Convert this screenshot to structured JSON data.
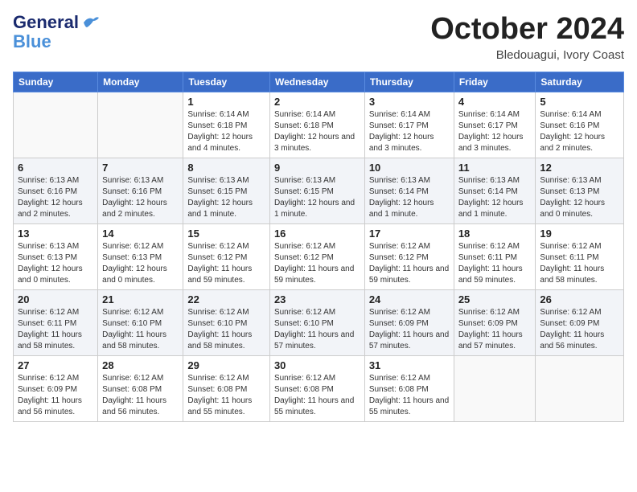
{
  "header": {
    "logo_line1": "General",
    "logo_line2": "Blue",
    "month": "October 2024",
    "location": "Bledouagui, Ivory Coast"
  },
  "weekdays": [
    "Sunday",
    "Monday",
    "Tuesday",
    "Wednesday",
    "Thursday",
    "Friday",
    "Saturday"
  ],
  "weeks": [
    [
      {
        "day": "",
        "sunrise": "",
        "sunset": "",
        "daylight": ""
      },
      {
        "day": "",
        "sunrise": "",
        "sunset": "",
        "daylight": ""
      },
      {
        "day": "1",
        "sunrise": "Sunrise: 6:14 AM",
        "sunset": "Sunset: 6:18 PM",
        "daylight": "Daylight: 12 hours and 4 minutes."
      },
      {
        "day": "2",
        "sunrise": "Sunrise: 6:14 AM",
        "sunset": "Sunset: 6:18 PM",
        "daylight": "Daylight: 12 hours and 3 minutes."
      },
      {
        "day": "3",
        "sunrise": "Sunrise: 6:14 AM",
        "sunset": "Sunset: 6:17 PM",
        "daylight": "Daylight: 12 hours and 3 minutes."
      },
      {
        "day": "4",
        "sunrise": "Sunrise: 6:14 AM",
        "sunset": "Sunset: 6:17 PM",
        "daylight": "Daylight: 12 hours and 3 minutes."
      },
      {
        "day": "5",
        "sunrise": "Sunrise: 6:14 AM",
        "sunset": "Sunset: 6:16 PM",
        "daylight": "Daylight: 12 hours and 2 minutes."
      }
    ],
    [
      {
        "day": "6",
        "sunrise": "Sunrise: 6:13 AM",
        "sunset": "Sunset: 6:16 PM",
        "daylight": "Daylight: 12 hours and 2 minutes."
      },
      {
        "day": "7",
        "sunrise": "Sunrise: 6:13 AM",
        "sunset": "Sunset: 6:16 PM",
        "daylight": "Daylight: 12 hours and 2 minutes."
      },
      {
        "day": "8",
        "sunrise": "Sunrise: 6:13 AM",
        "sunset": "Sunset: 6:15 PM",
        "daylight": "Daylight: 12 hours and 1 minute."
      },
      {
        "day": "9",
        "sunrise": "Sunrise: 6:13 AM",
        "sunset": "Sunset: 6:15 PM",
        "daylight": "Daylight: 12 hours and 1 minute."
      },
      {
        "day": "10",
        "sunrise": "Sunrise: 6:13 AM",
        "sunset": "Sunset: 6:14 PM",
        "daylight": "Daylight: 12 hours and 1 minute."
      },
      {
        "day": "11",
        "sunrise": "Sunrise: 6:13 AM",
        "sunset": "Sunset: 6:14 PM",
        "daylight": "Daylight: 12 hours and 1 minute."
      },
      {
        "day": "12",
        "sunrise": "Sunrise: 6:13 AM",
        "sunset": "Sunset: 6:13 PM",
        "daylight": "Daylight: 12 hours and 0 minutes."
      }
    ],
    [
      {
        "day": "13",
        "sunrise": "Sunrise: 6:13 AM",
        "sunset": "Sunset: 6:13 PM",
        "daylight": "Daylight: 12 hours and 0 minutes."
      },
      {
        "day": "14",
        "sunrise": "Sunrise: 6:12 AM",
        "sunset": "Sunset: 6:13 PM",
        "daylight": "Daylight: 12 hours and 0 minutes."
      },
      {
        "day": "15",
        "sunrise": "Sunrise: 6:12 AM",
        "sunset": "Sunset: 6:12 PM",
        "daylight": "Daylight: 11 hours and 59 minutes."
      },
      {
        "day": "16",
        "sunrise": "Sunrise: 6:12 AM",
        "sunset": "Sunset: 6:12 PM",
        "daylight": "Daylight: 11 hours and 59 minutes."
      },
      {
        "day": "17",
        "sunrise": "Sunrise: 6:12 AM",
        "sunset": "Sunset: 6:12 PM",
        "daylight": "Daylight: 11 hours and 59 minutes."
      },
      {
        "day": "18",
        "sunrise": "Sunrise: 6:12 AM",
        "sunset": "Sunset: 6:11 PM",
        "daylight": "Daylight: 11 hours and 59 minutes."
      },
      {
        "day": "19",
        "sunrise": "Sunrise: 6:12 AM",
        "sunset": "Sunset: 6:11 PM",
        "daylight": "Daylight: 11 hours and 58 minutes."
      }
    ],
    [
      {
        "day": "20",
        "sunrise": "Sunrise: 6:12 AM",
        "sunset": "Sunset: 6:11 PM",
        "daylight": "Daylight: 11 hours and 58 minutes."
      },
      {
        "day": "21",
        "sunrise": "Sunrise: 6:12 AM",
        "sunset": "Sunset: 6:10 PM",
        "daylight": "Daylight: 11 hours and 58 minutes."
      },
      {
        "day": "22",
        "sunrise": "Sunrise: 6:12 AM",
        "sunset": "Sunset: 6:10 PM",
        "daylight": "Daylight: 11 hours and 58 minutes."
      },
      {
        "day": "23",
        "sunrise": "Sunrise: 6:12 AM",
        "sunset": "Sunset: 6:10 PM",
        "daylight": "Daylight: 11 hours and 57 minutes."
      },
      {
        "day": "24",
        "sunrise": "Sunrise: 6:12 AM",
        "sunset": "Sunset: 6:09 PM",
        "daylight": "Daylight: 11 hours and 57 minutes."
      },
      {
        "day": "25",
        "sunrise": "Sunrise: 6:12 AM",
        "sunset": "Sunset: 6:09 PM",
        "daylight": "Daylight: 11 hours and 57 minutes."
      },
      {
        "day": "26",
        "sunrise": "Sunrise: 6:12 AM",
        "sunset": "Sunset: 6:09 PM",
        "daylight": "Daylight: 11 hours and 56 minutes."
      }
    ],
    [
      {
        "day": "27",
        "sunrise": "Sunrise: 6:12 AM",
        "sunset": "Sunset: 6:09 PM",
        "daylight": "Daylight: 11 hours and 56 minutes."
      },
      {
        "day": "28",
        "sunrise": "Sunrise: 6:12 AM",
        "sunset": "Sunset: 6:08 PM",
        "daylight": "Daylight: 11 hours and 56 minutes."
      },
      {
        "day": "29",
        "sunrise": "Sunrise: 6:12 AM",
        "sunset": "Sunset: 6:08 PM",
        "daylight": "Daylight: 11 hours and 55 minutes."
      },
      {
        "day": "30",
        "sunrise": "Sunrise: 6:12 AM",
        "sunset": "Sunset: 6:08 PM",
        "daylight": "Daylight: 11 hours and 55 minutes."
      },
      {
        "day": "31",
        "sunrise": "Sunrise: 6:12 AM",
        "sunset": "Sunset: 6:08 PM",
        "daylight": "Daylight: 11 hours and 55 minutes."
      },
      {
        "day": "",
        "sunrise": "",
        "sunset": "",
        "daylight": ""
      },
      {
        "day": "",
        "sunrise": "",
        "sunset": "",
        "daylight": ""
      }
    ]
  ]
}
